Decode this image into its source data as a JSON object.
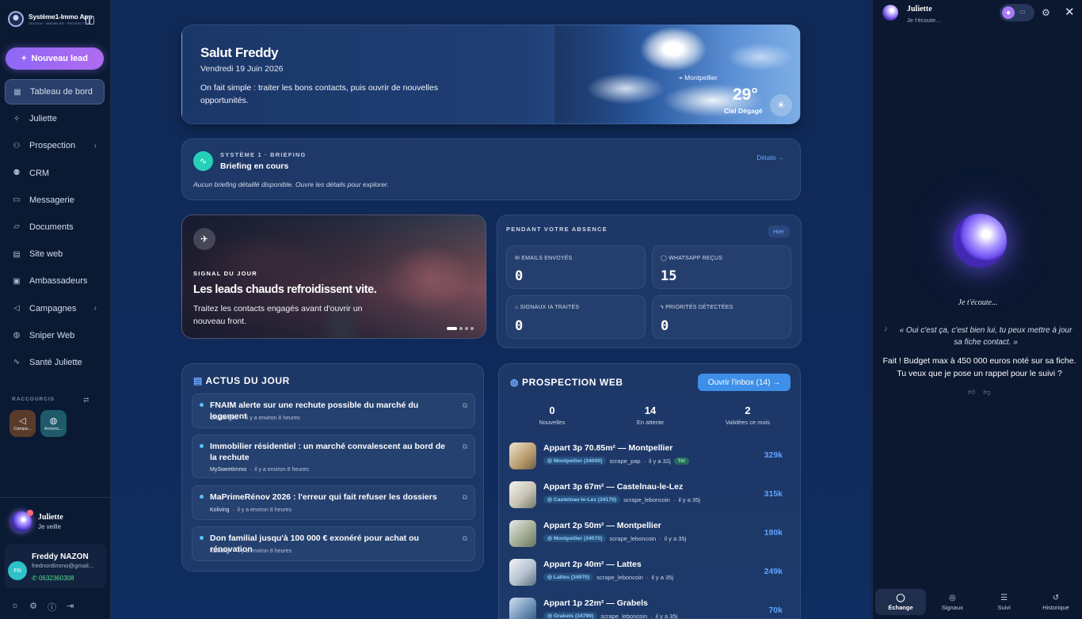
{
  "app": {
    "name": "Système1-Immo App",
    "tagline": "GESTION · IMMOBILIER · PROSPECTION"
  },
  "sidebar": {
    "new_lead": "Nouveau lead",
    "items": [
      {
        "label": "Tableau de bord",
        "icon": "grid-icon",
        "active": true
      },
      {
        "label": "Juliette",
        "icon": "sparkle-icon"
      },
      {
        "label": "Prospection",
        "icon": "user-plus-icon",
        "has_submenu": true
      },
      {
        "label": "CRM",
        "icon": "users-icon"
      },
      {
        "label": "Messagerie",
        "icon": "message-icon"
      },
      {
        "label": "Documents",
        "icon": "folder-icon"
      },
      {
        "label": "Site web",
        "icon": "browser-icon"
      },
      {
        "label": "Ambassadeurs",
        "icon": "gift-icon"
      },
      {
        "label": "Campagnes",
        "icon": "megaphone-icon",
        "has_submenu": true
      },
      {
        "label": "Sniper Web",
        "icon": "globe-icon"
      },
      {
        "label": "Santé Juliette",
        "icon": "pulse-icon"
      }
    ],
    "shortcuts_label": "RACCOURCIS",
    "shortcuts": [
      {
        "label": "Campa...",
        "icon": "megaphone-icon"
      },
      {
        "label": "Annonc...",
        "icon": "globe-icon"
      }
    ],
    "assistant": {
      "name": "Juliette",
      "status": "Je veille"
    },
    "user": {
      "initials": "FN",
      "name": "Freddy NAZON",
      "email": "frednordimmo@gmail...",
      "phone": "0632360308"
    }
  },
  "hero": {
    "greeting": "Salut Freddy",
    "date": "Vendredi 19 Juin 2026",
    "text": "On fait simple : traiter les bons contacts, puis ouvrir de nouvelles opportunités.",
    "location": "Montpellier",
    "temperature": "29°",
    "sky": "Ciel Dégagé"
  },
  "briefing": {
    "kicker": "SYSTÈME 1 · BRIEFING",
    "title": "Briefing en cours",
    "link": "Détails →",
    "note": "Aucun briefing détaillé disponible. Ouvre les détails pour explorer."
  },
  "signal": {
    "kicker": "SIGNAL DU JOUR",
    "title": "Les leads chauds refroidissent vite.",
    "text": "Traitez les contacts engagés avant d'ouvrir un nouveau front."
  },
  "absence": {
    "title": "PENDANT VOTRE ABSENCE",
    "chip": "Hier",
    "stats": [
      {
        "label": "EMAILS ENVOYÉS",
        "value": "0",
        "icon": "mail-icon"
      },
      {
        "label": "WHATSAPP REÇUS",
        "value": "15",
        "icon": "chat-icon"
      },
      {
        "label": "SIGNAUX IA TRAITÉS",
        "value": "0",
        "icon": "robot-icon"
      },
      {
        "label": "PRIORITÉS DÉTECTÉES",
        "value": "0",
        "icon": "bolt-icon"
      }
    ]
  },
  "actus": {
    "title": "ACTUS DU JOUR",
    "items": [
      {
        "title": "FNAIM alerte sur une rechute possible du marché du logement",
        "source": "Challenges",
        "time": "il y a environ 8 heures"
      },
      {
        "title": "Immobilier résidentiel : un marché convalescent au bord de la rechute",
        "source": "MySweetImmo",
        "time": "il y a environ 8 heures"
      },
      {
        "title": "MaPrimeRénov 2026 : l'erreur qui fait refuser les dossiers",
        "source": "Koliving",
        "time": "il y a environ 8 heures"
      },
      {
        "title": "Don familial jusqu'à 100 000 € exonéré pour achat ou rénovation",
        "source": "Koliving",
        "time": "il y a environ 8 heures"
      }
    ]
  },
  "prospection": {
    "title": "PROSPECTION WEB",
    "inbox_button": "Ouvrir l'inbox (14)",
    "stats": [
      {
        "value": "0",
        "label": "Nouvelles"
      },
      {
        "value": "14",
        "label": "En attente"
      },
      {
        "value": "2",
        "label": "Validées ce mois"
      }
    ],
    "listings": [
      {
        "title": "Appart 3p 70.85m² — Montpellier",
        "tag": "Montpellier (34000)",
        "source": "scrape_pap",
        "age": "il y a 32j",
        "badge": "Tel",
        "price": "329k"
      },
      {
        "title": "Appart 3p 67m² — Castelnau-le-Lez",
        "tag": "Castelnau-le-Lez (34170)",
        "source": "scrape_leboncoin",
        "age": "il y a 35j",
        "price": "315k"
      },
      {
        "title": "Appart 2p 50m² — Montpellier",
        "tag": "Montpellier (34070)",
        "source": "scrape_leboncoin",
        "age": "il y a 35j",
        "price": "180k"
      },
      {
        "title": "Appart 2p 40m² — Lattes",
        "tag": "Lattes (34970)",
        "source": "scrape_leboncoin",
        "age": "il y a 35j",
        "price": "249k"
      },
      {
        "title": "Appart 1p 22m² — Grabels",
        "tag": "Grabels (34790)",
        "source": "scrape_leboncoin",
        "age": "il y a 35j",
        "price": "70k"
      }
    ]
  },
  "assistant_panel": {
    "name": "Juliette",
    "status": "Je t'écoute...",
    "listening": "Je t'écoute...",
    "user_quote": "« Oui c'est ça, c'est bien lui, tu peux mettre à jour sa fiche contact. »",
    "answer": "Fait ! Budget max à 450 000 euros noté sur sa fiche. Tu veux que je pose un rappel pour le suivi ?",
    "tabs": [
      {
        "label": "Échange",
        "icon": "chat-icon",
        "active": true
      },
      {
        "label": "Signaux",
        "icon": "radar-icon"
      },
      {
        "label": "Suivi",
        "icon": "checklist-icon"
      },
      {
        "label": "Historique",
        "icon": "history-icon"
      }
    ]
  },
  "colors": {
    "accent": "#8e67f5",
    "link": "#5fa3ff",
    "background": "#0f2a5a",
    "sidebar": "#0b1a33",
    "whatsapp": "#4fe08a"
  }
}
